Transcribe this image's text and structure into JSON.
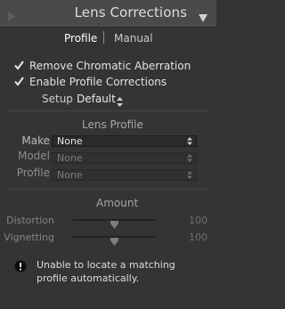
{
  "header": {
    "title": "Lens Corrections",
    "expand_icon": "disclosure-triangle-icon",
    "collapse_icon": "collapse-triangle-icon"
  },
  "tabs": [
    {
      "label": "Profile",
      "selected": true
    },
    {
      "label": "Manual",
      "selected": false
    }
  ],
  "options": {
    "remove_chromatic_aberration": {
      "label": "Remove Chromatic Aberration",
      "checked": true
    },
    "enable_profile_corrections": {
      "label": "Enable Profile Corrections",
      "checked": true
    }
  },
  "setup": {
    "label": "Setup",
    "value": "Default"
  },
  "lens_profile": {
    "title": "Lens Profile",
    "make": {
      "label": "Make",
      "value": "None",
      "enabled": true
    },
    "model": {
      "label": "Model",
      "value": "None",
      "enabled": false
    },
    "profile": {
      "label": "Profile",
      "value": "None",
      "enabled": false
    }
  },
  "amount": {
    "title": "Amount",
    "distortion": {
      "label": "Distortion",
      "value": "100",
      "level": 0.5
    },
    "vignetting": {
      "label": "Vignetting",
      "value": "100",
      "level": 0.5
    }
  },
  "warning": {
    "icon": "alert-icon",
    "line1": "Unable to locate a matching",
    "line2": "profile automatically."
  },
  "colors": {
    "panel_bg": "#343434",
    "header_bg": "#4a4a4a",
    "text": "#dedede",
    "disabled_text": "#7c7c7c"
  }
}
